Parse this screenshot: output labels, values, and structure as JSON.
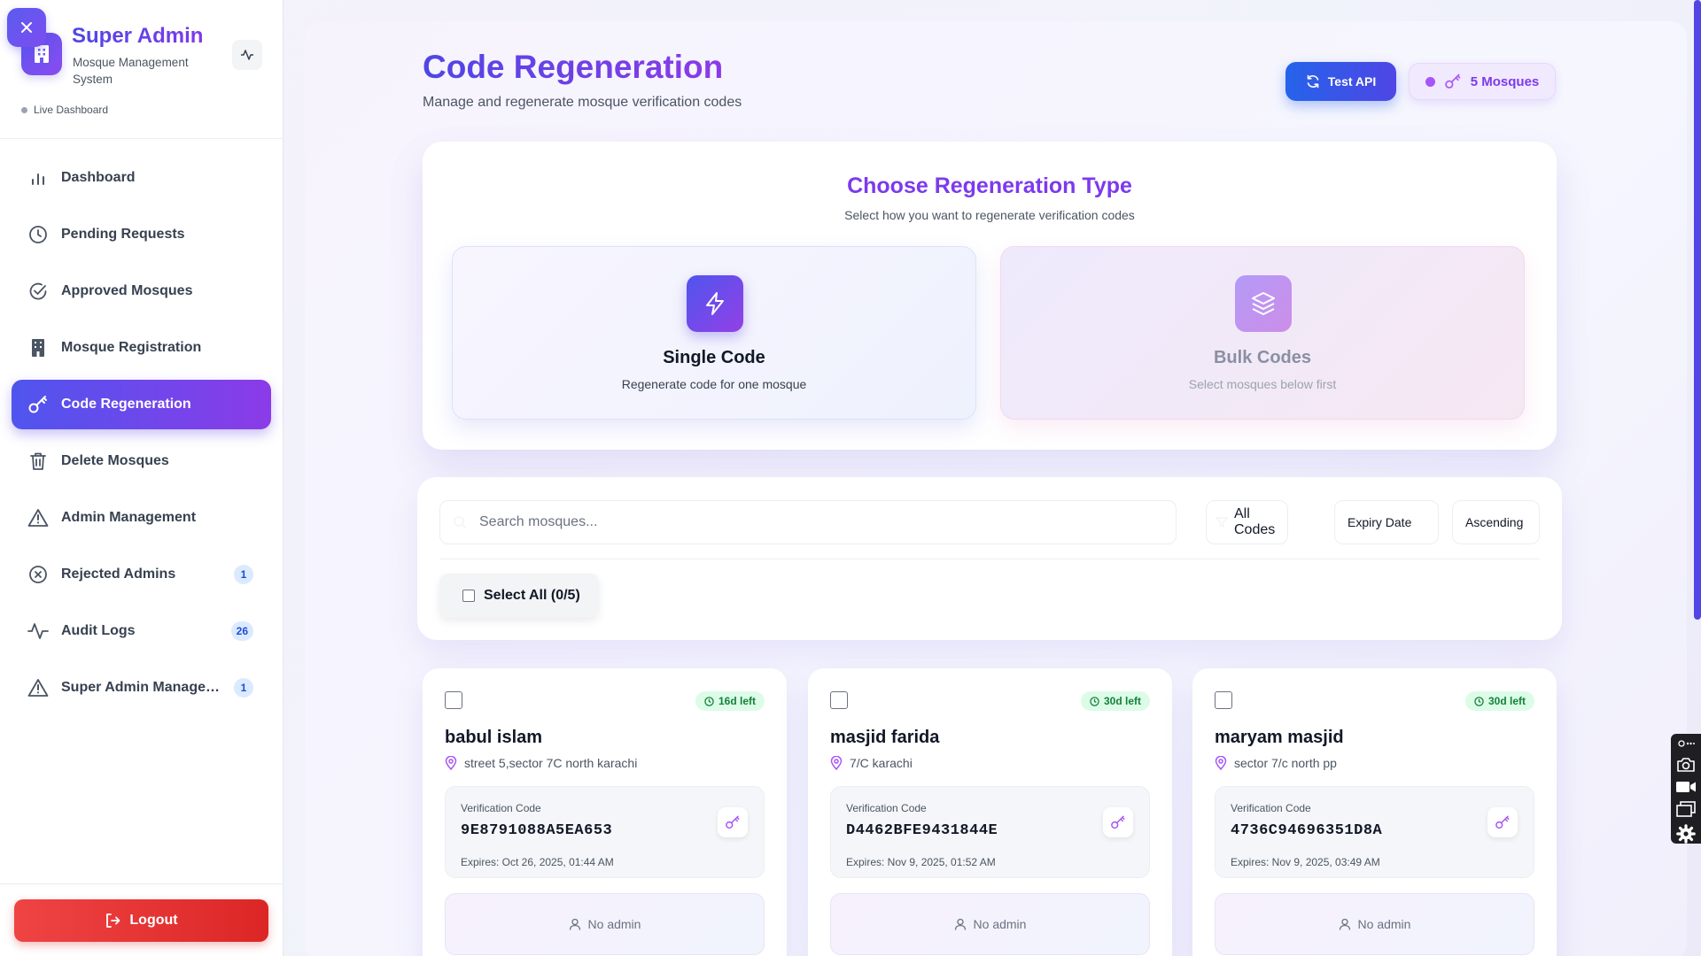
{
  "sidebar": {
    "brand_title": "Super Admin",
    "brand_subtitle": "Mosque Management System",
    "live_label": "Live Dashboard",
    "items": [
      {
        "label": "Dashboard",
        "icon": "bar-chart-icon"
      },
      {
        "label": "Pending Requests",
        "icon": "clock-icon"
      },
      {
        "label": "Approved Mosques",
        "icon": "check-circle-icon"
      },
      {
        "label": "Mosque Registration",
        "icon": "building-icon"
      },
      {
        "label": "Code Regeneration",
        "icon": "key-icon",
        "active": true
      },
      {
        "label": "Delete Mosques",
        "icon": "trash-icon"
      },
      {
        "label": "Admin Management",
        "icon": "warning-icon"
      },
      {
        "label": "Rejected Admins",
        "icon": "x-circle-icon",
        "badge": "1"
      },
      {
        "label": "Audit Logs",
        "icon": "activity-icon",
        "badge": "26"
      },
      {
        "label": "Super Admin Managem...",
        "icon": "warning-icon",
        "badge": "1"
      }
    ],
    "logout_label": "Logout"
  },
  "header": {
    "title": "Code Regeneration",
    "subtitle": "Manage and regenerate mosque verification codes",
    "test_api_label": "Test API",
    "mosque_count_label": "5 Mosques"
  },
  "regen": {
    "title": "Choose Regeneration Type",
    "subtitle": "Select how you want to regenerate verification codes",
    "single": {
      "title": "Single Code",
      "subtitle": "Regenerate code for one mosque"
    },
    "bulk": {
      "title": "Bulk Codes",
      "subtitle": "Select mosques below first"
    }
  },
  "filters": {
    "search_placeholder": "Search mosques...",
    "codes_filter": "All Codes",
    "sort_by": "Expiry Date",
    "sort_order": "Ascending",
    "select_all_label": "Select All (0/5)"
  },
  "mosques": [
    {
      "name": "babul islam",
      "address": "street 5,sector 7C north karachi",
      "expiry_badge": "16d left",
      "code_label": "Verification Code",
      "code": "9E8791088A5EA653",
      "expires": "Expires: Oct 26, 2025, 01:44 AM",
      "admin": "No admin"
    },
    {
      "name": "masjid farida",
      "address": "7/C karachi",
      "expiry_badge": "30d left",
      "code_label": "Verification Code",
      "code": "D4462BFE9431844E",
      "expires": "Expires: Nov 9, 2025, 01:52 AM",
      "admin": "No admin"
    },
    {
      "name": "maryam masjid",
      "address": "sector 7/c north pp",
      "expiry_badge": "30d left",
      "code_label": "Verification Code",
      "code": "4736C94696351D8A",
      "expires": "Expires: Nov 9, 2025, 03:49 AM",
      "admin": "No admin"
    }
  ],
  "colors": {
    "primary": "#4f46e5",
    "accent": "#7c3aed",
    "danger": "#dc2626",
    "success": "#15803d"
  }
}
